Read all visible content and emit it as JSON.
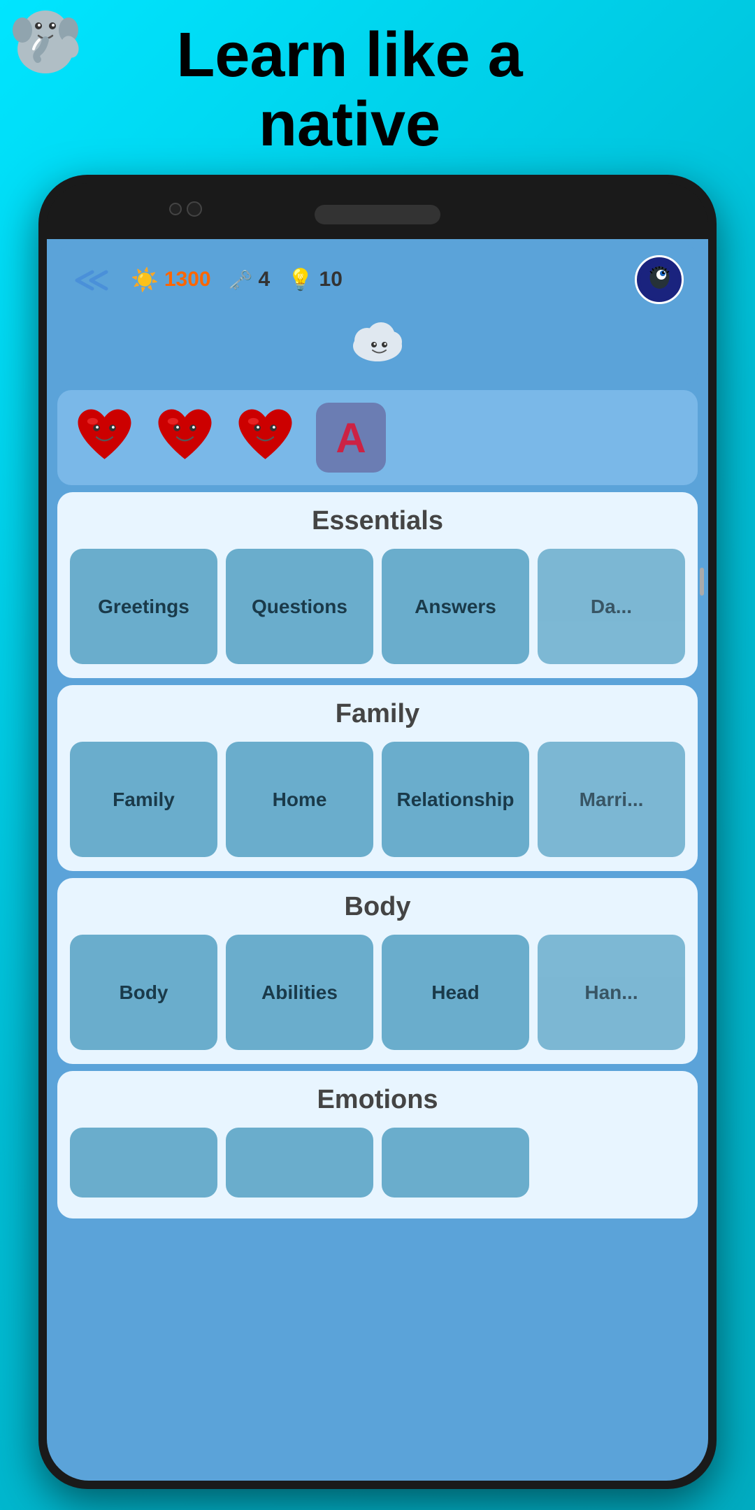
{
  "header": {
    "tagline_line1": "Learn like a",
    "tagline_line2": "native"
  },
  "stats": {
    "sun_score": "1300",
    "keys": "4",
    "bulbs": "10"
  },
  "lives": {
    "hearts": 3,
    "letter": "A"
  },
  "sections": [
    {
      "title": "Essentials",
      "items": [
        "Greetings",
        "Questions",
        "Answers",
        "Da..."
      ]
    },
    {
      "title": "Family",
      "items": [
        "Family",
        "Home",
        "Relationship",
        "Marri..."
      ]
    },
    {
      "title": "Body",
      "items": [
        "Body",
        "Abilities",
        "Head",
        "Han..."
      ]
    },
    {
      "title": "Emotions",
      "items": [
        "",
        "",
        ""
      ]
    }
  ]
}
